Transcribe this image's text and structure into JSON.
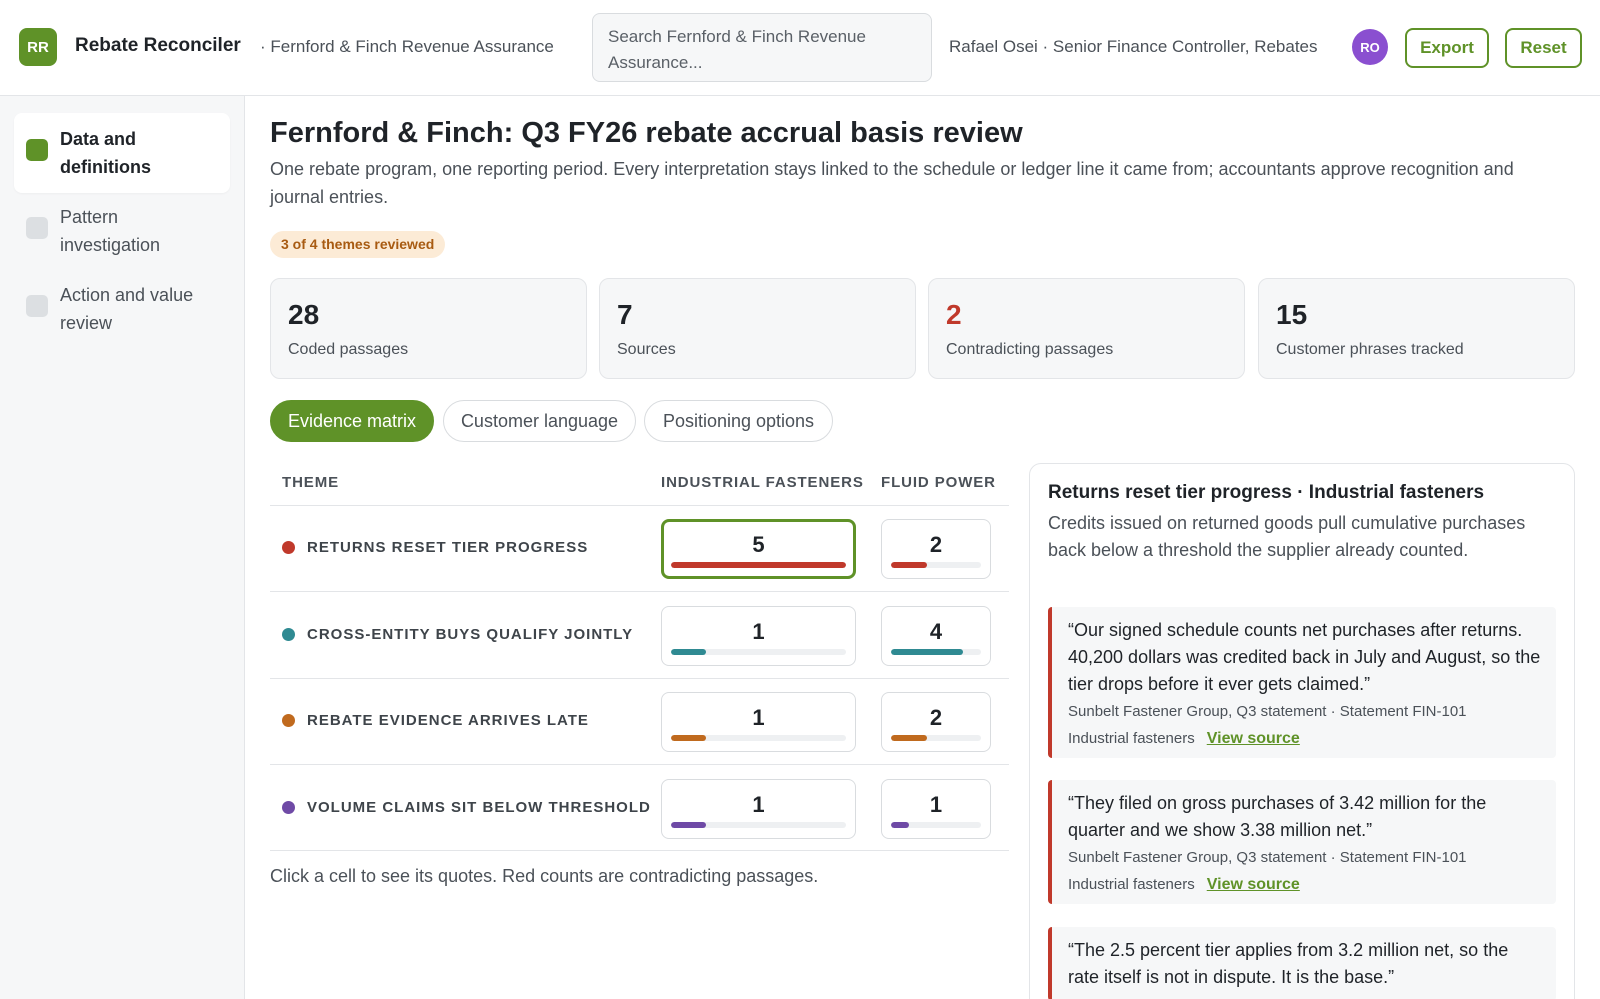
{
  "app": {
    "logo_text": "RR",
    "name": "Rebate Reconciler",
    "org": "· Fernford & Finch Revenue Assurance",
    "search_placeholder": "Search Fernford & Finch Revenue Assurance...",
    "user": "Rafael Osei · Senior Finance Controller, Rebates",
    "avatar_initials": "RO",
    "export_label": "Export",
    "reset_label": "Reset",
    "accent_color": "#5f9228"
  },
  "sidebar": {
    "items": [
      {
        "label": "Data and definitions",
        "active": true
      },
      {
        "label": "Pattern investigation",
        "active": false
      },
      {
        "label": "Action and value review",
        "active": false
      }
    ]
  },
  "page": {
    "title": "Fernford & Finch: Q3 FY26 rebate accrual basis review",
    "description": "One rebate program, one reporting period. Every interpretation stays linked to the schedule or ledger line it came from; accountants approve recognition and journal entries.",
    "review_badge": "3 of 4 themes reviewed"
  },
  "stats": [
    {
      "value": "28",
      "label": "Coded passages"
    },
    {
      "value": "7",
      "label": "Sources"
    },
    {
      "value": "2",
      "label": "Contradicting passages"
    },
    {
      "value": "15",
      "label": "Customer phrases tracked"
    }
  ],
  "tabs": [
    {
      "label": "Evidence matrix",
      "active": true
    },
    {
      "label": "Customer language",
      "active": false
    },
    {
      "label": "Positioning options",
      "active": false
    }
  ],
  "matrix": {
    "headers": {
      "theme": "THEME",
      "col1": "INDUSTRIAL FASTENERS",
      "col2": "FLUID POWER"
    },
    "rows": [
      {
        "theme": "RETURNS RESET TIER PROGRESS",
        "color": "#c0392b",
        "col1": {
          "value": "5",
          "fill": 1.0
        },
        "col2": {
          "value": "2",
          "fill": 0.4
        }
      },
      {
        "theme": "CROSS-ENTITY BUYS QUALIFY JOINTLY",
        "color": "#2f8a92",
        "col1": {
          "value": "1",
          "fill": 0.2
        },
        "col2": {
          "value": "4",
          "fill": 0.8
        }
      },
      {
        "theme": "REBATE EVIDENCE ARRIVES LATE",
        "color": "#c06a1e",
        "col1": {
          "value": "1",
          "fill": 0.2
        },
        "col2": {
          "value": "2",
          "fill": 0.4
        }
      },
      {
        "theme": "VOLUME CLAIMS SIT BELOW THRESHOLD",
        "color": "#6f4aa6",
        "col1": {
          "value": "1",
          "fill": 0.2
        },
        "col2": {
          "value": "1",
          "fill": 0.2
        }
      }
    ],
    "note": "Click a cell to see its quotes. Red counts are contradicting passages."
  },
  "panel": {
    "title": "Returns reset tier progress · Industrial fasteners",
    "description": "Credits issued on returned goods pull cumulative purchases back below a threshold the supplier already counted.",
    "quotes": [
      {
        "text": "“Our signed schedule counts net purchases after returns. 40,200 dollars was credited back in July and August, so the tier drops before it ever gets claimed.”",
        "cite": "Sunbelt Fastener Group, Q3 statement · Statement FIN-101",
        "segment": "Industrial fasteners",
        "link": "View source"
      },
      {
        "text": "“They filed on gross purchases of 3.42 million for the quarter and we show 3.38 million net.”",
        "cite": "Sunbelt Fastener Group, Q3 statement · Statement FIN-101",
        "segment": "Industrial fasteners",
        "link": "View source"
      },
      {
        "text": "“The 2.5 percent tier applies from 3.2 million net, so the rate itself is not in dispute. It is the base.”"
      }
    ]
  }
}
